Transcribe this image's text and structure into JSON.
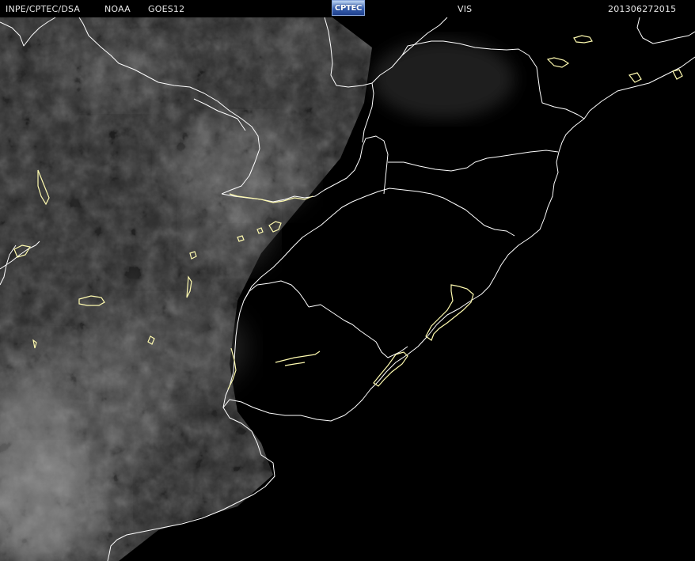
{
  "header": {
    "agency": "INPE/CPTEC/DSA",
    "source": "NOAA",
    "satellite": "GOES12",
    "logo_text": "CPTEC",
    "channel": "VIS",
    "timestamp": "201306272015"
  },
  "colors": {
    "background": "#000000",
    "header_text": "#e8e8e8",
    "coastline": "#ffffff",
    "coastline_highlight": "#fffbb0",
    "cloud": "#9a9a9a"
  },
  "map": {
    "region": "South America - southern Brazil, Uruguay, Argentina",
    "overlay": "political boundaries and coastline"
  }
}
